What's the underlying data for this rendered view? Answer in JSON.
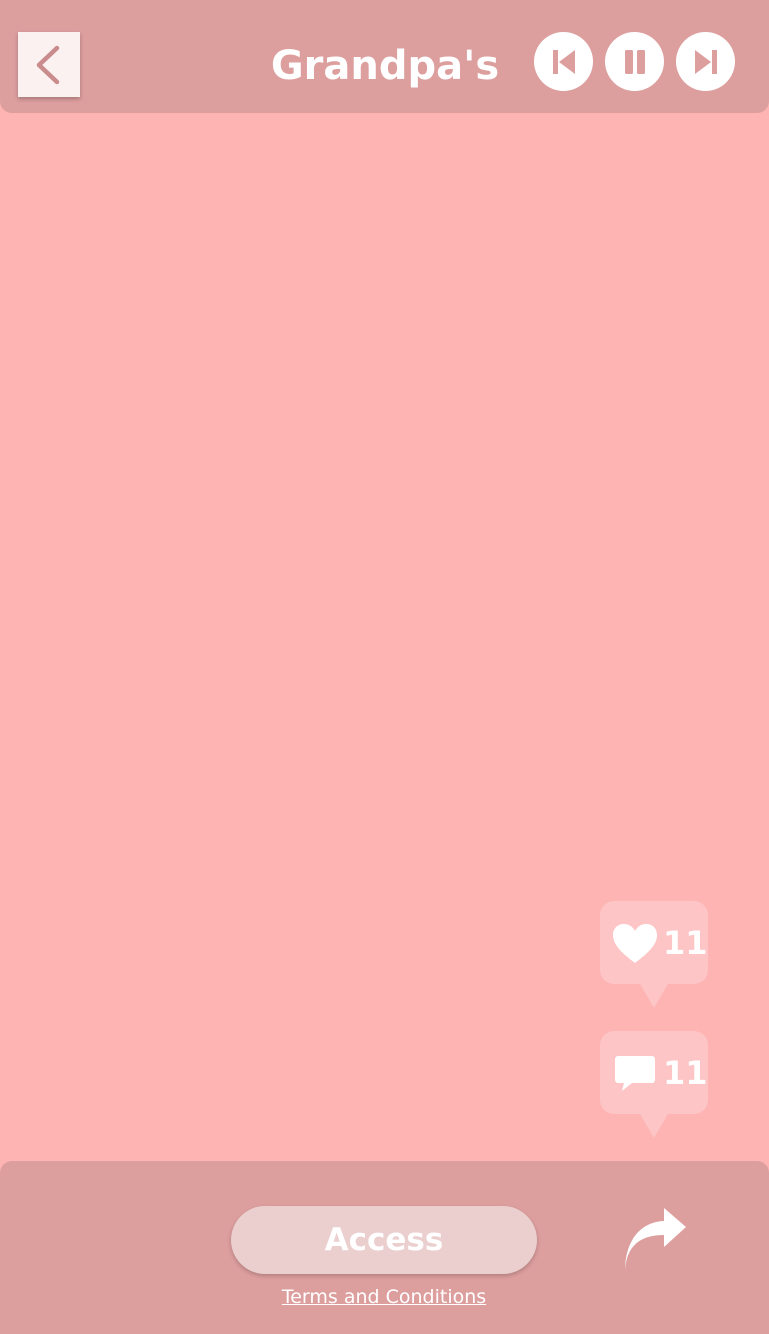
{
  "header": {
    "title": "Grandpa's",
    "back_icon": "chevron-left-icon",
    "controls": [
      {
        "name": "previous",
        "icon": "skip-previous-icon"
      },
      {
        "name": "pause",
        "icon": "pause-icon"
      },
      {
        "name": "next",
        "icon": "skip-next-icon"
      }
    ]
  },
  "reactions": {
    "likes": {
      "icon": "heart-icon",
      "count": "11"
    },
    "comments": {
      "icon": "comment-icon",
      "count": "11"
    }
  },
  "footer": {
    "access_label": "Access",
    "terms_label": "Terms and Conditions",
    "share_icon": "share-arrow-icon"
  },
  "colors": {
    "background": "#fdb4b3",
    "bars": "#dd9e9e",
    "bubble": "#fdc5c5",
    "access_button": "#ebcfcf",
    "accent_icon": "#c98b8b",
    "text": "#ffffff"
  }
}
